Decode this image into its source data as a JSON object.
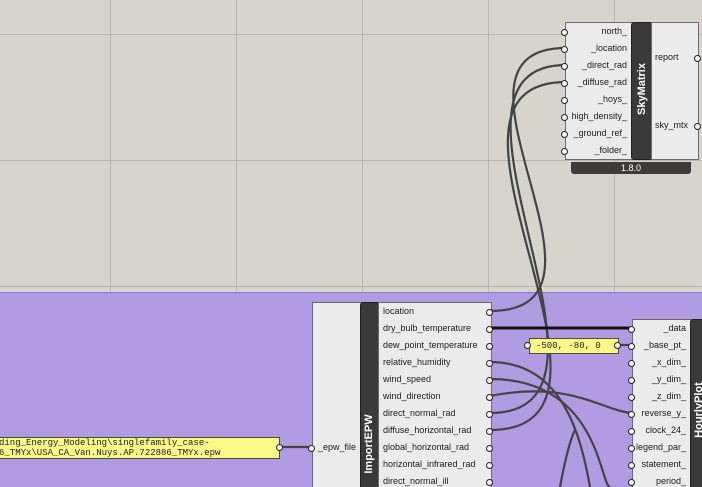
{
  "skymatrix": {
    "name": "SkyMatrix",
    "version": "1.8.0",
    "inputs": [
      "north_",
      "_location",
      "_direct_rad",
      "_diffuse_rad",
      "_hoys_",
      "high_density_",
      "_ground_ref_",
      "_folder_"
    ],
    "outputs": [
      "report",
      "sky_mtx"
    ]
  },
  "importepw": {
    "name": "ImportEPW",
    "input": "_epw_file",
    "outputs": [
      "location",
      "dry_bulb_temperature",
      "dew_point_temperature",
      "relative_humidity",
      "wind_speed",
      "wind_direction",
      "direct_normal_rad",
      "diffuse_horizontal_rad",
      "global_horizontal_rad",
      "horizontal_infrared_rad",
      "direct_normal_ill"
    ]
  },
  "hourlyplot": {
    "name": "HourlyPlot",
    "inputs": [
      "_data",
      "_base_pt_",
      "_x_dim_",
      "_y_dim_",
      "_z_dim_",
      "reverse_y_",
      "clock_24_",
      "legend_par_",
      "statement_",
      "period_"
    ]
  },
  "panels": {
    "point": "-500, -80, 0",
    "epw_path_line1": "ding_Energy_Modeling\\singlefamily_case-",
    "epw_path_line2": "6_TMYx\\USA_CA_Van.Nuys.AP.722886_TMYx.epw"
  }
}
